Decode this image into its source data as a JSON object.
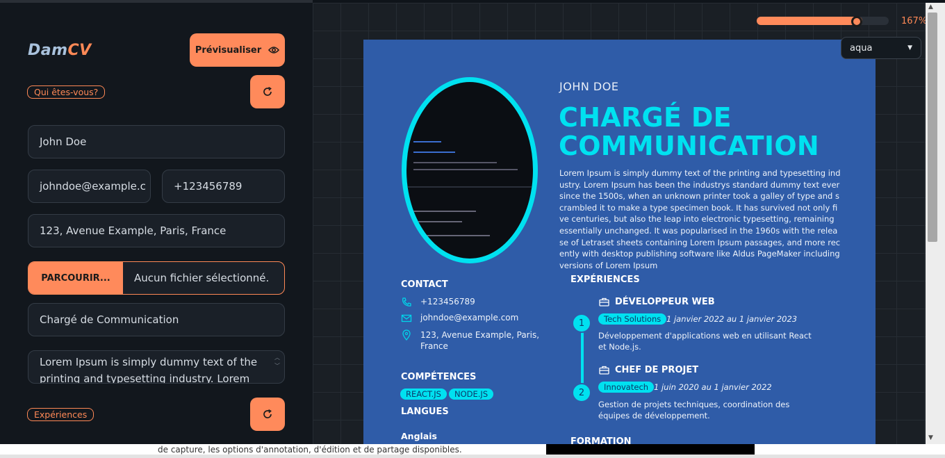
{
  "app": {
    "logo_part1": "Dam",
    "logo_part2": "CV",
    "preview_label": "Prévisualiser"
  },
  "sections": {
    "who_label": "Qui êtes-vous?",
    "experiences_label": "Expériences"
  },
  "form": {
    "name": "John Doe",
    "email": "johndoe@example.c",
    "phone": "+123456789",
    "address": "123, Avenue Example, Paris, France",
    "file_button": "PARCOURIR...",
    "file_status": "Aucun fichier sélectionné.",
    "job_title": "Chargé de Communication",
    "about": "Lorem Ipsum is simply dummy text of the printing and typesetting industry. Lorem"
  },
  "toolbar": {
    "zoom_label": "167%",
    "zoom_fraction": 0.8,
    "theme_value": "aqua"
  },
  "cv": {
    "name": "JOHN DOE",
    "title_line1": "CHARGÉ DE",
    "title_line2": "COMMUNICATION",
    "about": "Lorem Ipsum is simply dummy text of the printing and typesetting industry. Lorem Ipsum has been the industrys standard dummy text ever since the 1500s, when an unknown printer took a galley of type and scrambled it to make a type specimen book. It has survived not only five centuries, but also the leap into electronic typesetting, remaining essentially unchanged. It was popularised in the 1960s with the release of Letraset sheets containing Lorem Ipsum passages, and more recently with desktop publishing software like Aldus PageMaker including versions of Lorem Ipsum",
    "contact_heading": "CONTACT",
    "contact_phone": "+123456789",
    "contact_email": "johndoe@example.com",
    "contact_address": "123, Avenue Example, Paris, France",
    "skills_heading": "COMPÉTENCES",
    "skills": [
      "REACT.JS",
      "NODE.JS"
    ],
    "languages_heading": "LANGUES",
    "language_1": "Anglais",
    "experiences_heading": "EXPÉRIENCES",
    "jobs": [
      {
        "num": "1",
        "title": "DÉVELOPPEUR WEB",
        "company": "Tech Solutions",
        "dates": "1 janvier 2022 au 1 janvier 2023",
        "desc": "Développement d'applications web en utilisant React et Node.js."
      },
      {
        "num": "2",
        "title": "CHEF DE PROJET",
        "company": "Innovatech",
        "dates": "1 juin 2020 au 1 janvier 2022",
        "desc": "Gestion de projets techniques, coordination des équipes de développement."
      }
    ],
    "formation_heading": "FORMATION"
  },
  "bottom": {
    "text": "de capture, les options d'annotation, d'édition et de partage disponibles."
  }
}
